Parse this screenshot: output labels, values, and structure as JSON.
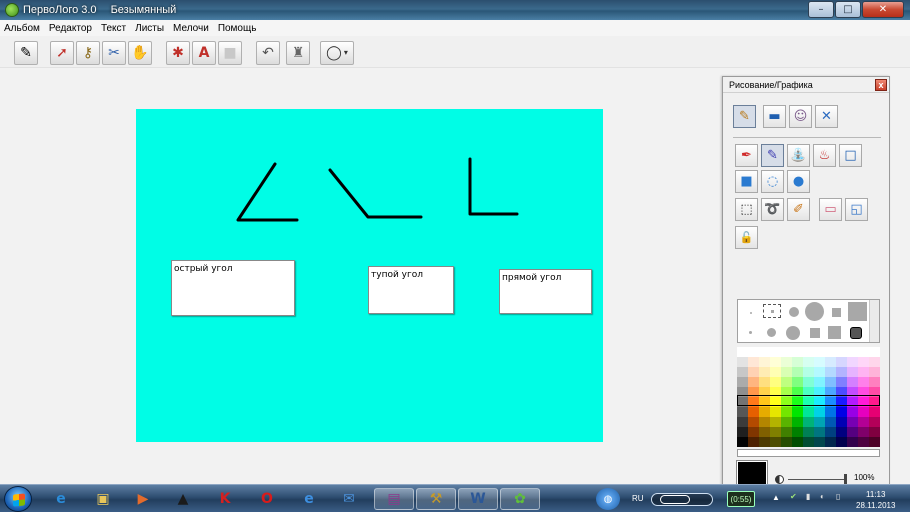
{
  "window": {
    "app_title": "ПервоЛого 3.0",
    "document_title": "Безымянный",
    "controls": {
      "minimize": "–",
      "maximize": "□",
      "close": "✕"
    }
  },
  "menu": [
    "Альбом",
    "Редактор",
    "Текст",
    "Листы",
    "Мелочи",
    "Помощь"
  ],
  "toolbar": {
    "tools": [
      {
        "name": "pencil-tool-button",
        "icon": "✎",
        "pressed": true
      },
      {
        "name": "arrow-select-button",
        "icon": "➚",
        "pressed": false
      },
      {
        "name": "turtle-key-button",
        "icon": "⚷",
        "pressed": false
      },
      {
        "name": "scissors-button",
        "icon": "✂",
        "pressed": false
      },
      {
        "name": "hand-button",
        "icon": "✋",
        "pressed": false
      },
      {
        "name": "new-turtle-button",
        "icon": "✱",
        "pressed": false
      },
      {
        "name": "text-tool-button",
        "icon": "A",
        "pressed": false
      },
      {
        "name": "stamp-button",
        "icon": "■",
        "pressed": false
      },
      {
        "name": "undo-button",
        "icon": "↶",
        "pressed": false
      },
      {
        "name": "clean-up-button",
        "icon": "♜",
        "pressed": false
      },
      {
        "name": "shape-menu-button",
        "icon": "◯",
        "pressed": false
      }
    ]
  },
  "canvas": {
    "background": "#00fde6",
    "labels": [
      "острый угол",
      "тупой угол",
      "прямой угол"
    ]
  },
  "panel": {
    "title": "Рисование/Графика",
    "close": "x",
    "top_tabs": [
      {
        "name": "draw-tab-button",
        "icon": "✎",
        "pressed": true
      },
      {
        "name": "background-tab-button",
        "icon": "▬",
        "pressed": false
      },
      {
        "name": "shapes-tab-button",
        "icon": "☺",
        "pressed": false
      },
      {
        "name": "tools-tab-button",
        "icon": "✕",
        "pressed": false
      }
    ],
    "tool_rows": [
      [
        {
          "name": "brush-tool-button",
          "icon": "✒",
          "pressed": false
        },
        {
          "name": "pencil-tool-button",
          "icon": "✎",
          "pressed": true
        },
        {
          "name": "watering-can-button",
          "icon": "⛲",
          "pressed": false
        },
        {
          "name": "spray-button",
          "icon": "♨",
          "pressed": false
        },
        {
          "name": "rectangle-tool-button",
          "icon": "□",
          "pressed": false
        }
      ],
      [
        {
          "name": "filled-rect-button",
          "icon": "■",
          "pressed": false
        },
        {
          "name": "ellipse-tool-button",
          "icon": "◌",
          "pressed": false
        },
        {
          "name": "filled-ellipse-button",
          "icon": "●",
          "pressed": false
        }
      ],
      [
        {
          "name": "rect-select-button",
          "icon": "⬚",
          "pressed": false
        },
        {
          "name": "lasso-button",
          "icon": "➰",
          "pressed": false
        },
        {
          "name": "eyedropper-button",
          "icon": "✐",
          "pressed": false
        },
        {
          "name": "eraser-button",
          "icon": "▭",
          "pressed": false
        },
        {
          "name": "page-button",
          "icon": "◱",
          "pressed": false
        }
      ],
      [
        {
          "name": "lock-button",
          "icon": "🔓",
          "pressed": false
        }
      ]
    ],
    "opacity_label": "100%",
    "current_color": "#000000"
  },
  "taskbar": {
    "apps": [
      {
        "name": "ie-taskbar-icon",
        "icon": "e",
        "color": "#2a8bd8"
      },
      {
        "name": "explorer-taskbar-icon",
        "icon": "▣",
        "color": "#e8c65a"
      },
      {
        "name": "media-player-taskbar-icon",
        "icon": "▶",
        "color": "#e36b2c"
      },
      {
        "name": "hat-taskbar-icon",
        "icon": "▲",
        "color": "#1b1b1b"
      },
      {
        "name": "kaspersky-taskbar-icon",
        "icon": "K",
        "color": "#d42020"
      },
      {
        "name": "opera-taskbar-icon",
        "icon": "O",
        "color": "#d81b1b"
      },
      {
        "name": "ie-blue-taskbar-icon",
        "icon": "e",
        "color": "#3d8fe0"
      },
      {
        "name": "mail-taskbar-icon",
        "icon": "✉",
        "color": "#4a90d8"
      },
      {
        "name": "winrar-taskbar-icon",
        "icon": "▤",
        "color": "#8c3a8c"
      },
      {
        "name": "game-taskbar-icon",
        "icon": "⚒",
        "color": "#c49a2a"
      },
      {
        "name": "word-taskbar-icon",
        "icon": "W",
        "color": "#2b5797"
      },
      {
        "name": "pervologo-taskbar-icon",
        "icon": "✿",
        "color": "#5fbf3a"
      }
    ],
    "lang": "RU",
    "battery": "(0:55)",
    "time": "11:13",
    "date": "28.11.2013"
  }
}
